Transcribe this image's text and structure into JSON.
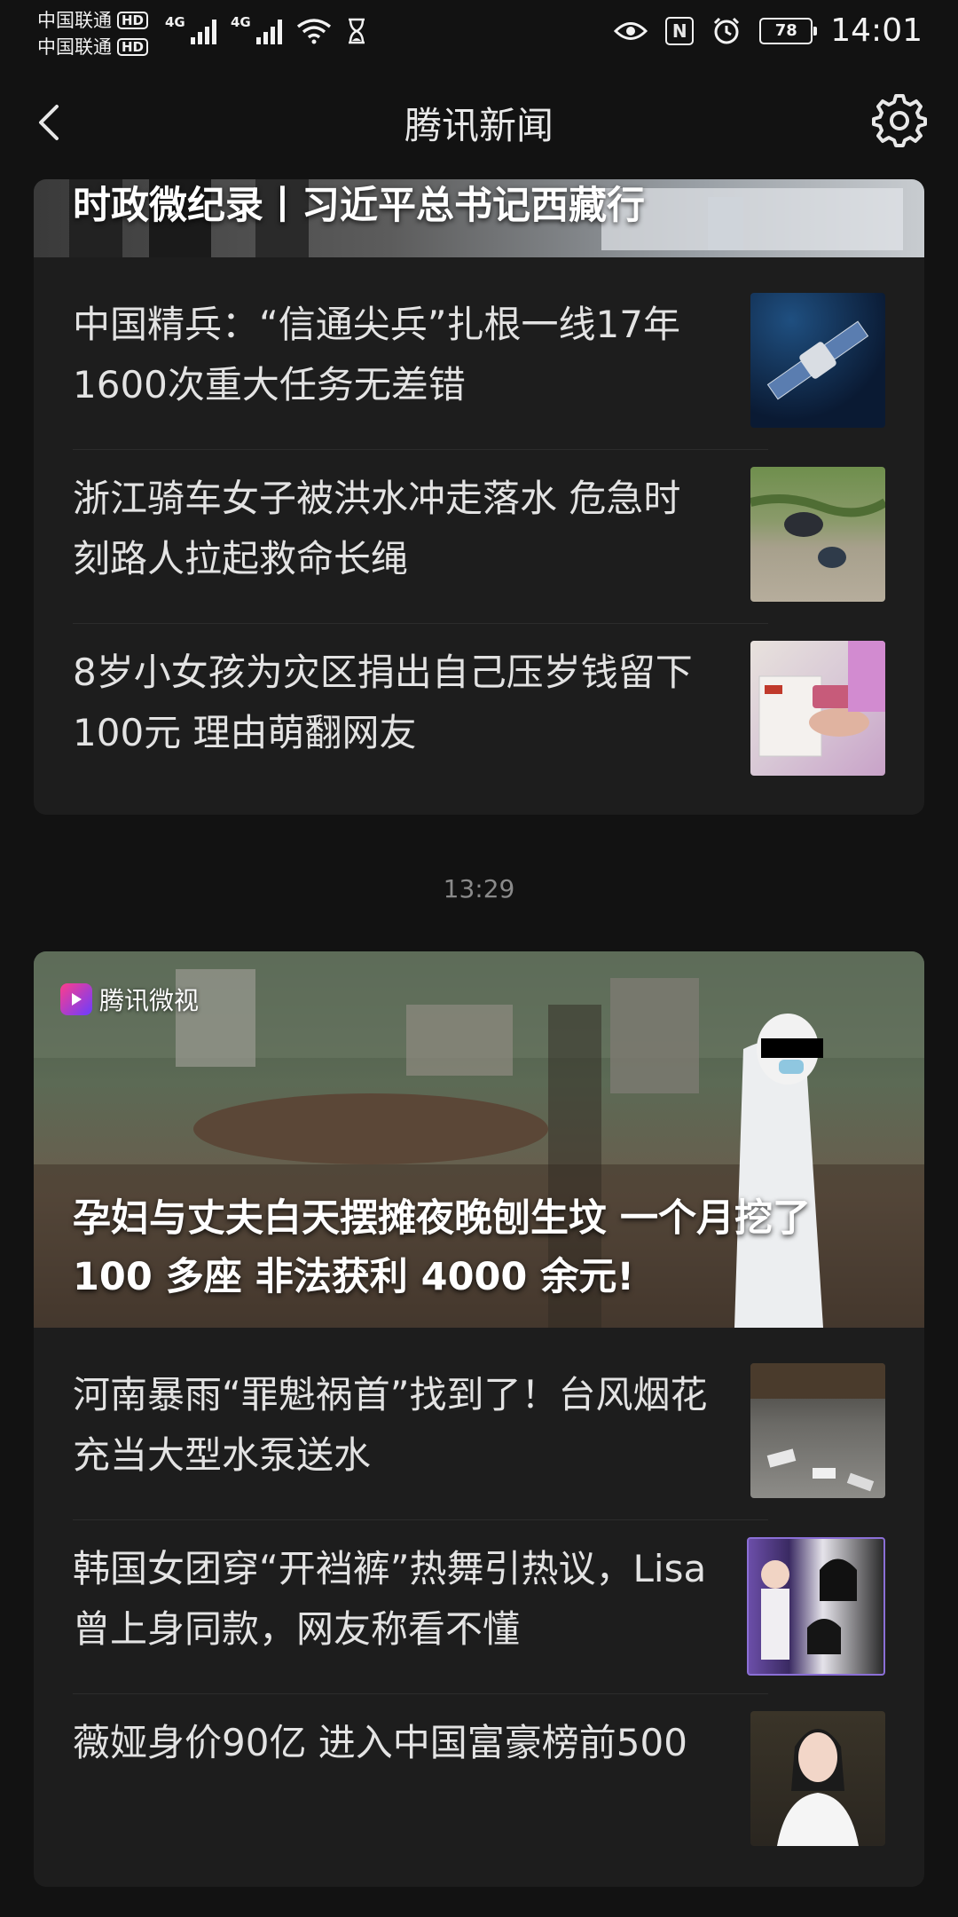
{
  "status_bar": {
    "carrier_1": "中国联通",
    "carrier_2": "中国联通",
    "hd_label": "HD",
    "network_1": "4G",
    "network_2": "4G",
    "battery": "78",
    "time": "14:01"
  },
  "header": {
    "title": "腾讯新闻"
  },
  "section_1": {
    "hero_title": "时政微纪录丨习近平总书记西藏行",
    "items": [
      {
        "title": "中国精兵：“信通尖兵”扎根一线17年 1600次重大任务无差错",
        "thumb_icon": "satellite-thumbnail"
      },
      {
        "title": "浙江骑车女子被洪水冲走落水 危急时刻路人拉起救命长绳",
        "thumb_icon": "flood-rescue-thumbnail"
      },
      {
        "title": "8岁小女孩为灾区捐出自己压岁钱留下100元 理由萌翻网友",
        "thumb_icon": "donation-thumbnail"
      }
    ]
  },
  "timestamp": "13:29",
  "section_2": {
    "badge": "腾讯微视",
    "hero_title": "孕妇与丈夫白天摆摊夜晚刨生坟 一个月挖了100 多座 非法获利 4000 余元!",
    "items": [
      {
        "title": "河南暴雨“罪魁祸首”找到了！台风烟花充当大型水泵送水",
        "thumb_icon": "flood-street-thumbnail"
      },
      {
        "title": "韩国女团穿“开裆裤”热舞引热议，Lisa曾上身同款，网友称看不懂",
        "thumb_icon": "girl-group-thumbnail"
      },
      {
        "title": "薇娅身价90亿 进入中国富豪榜前500",
        "thumb_icon": "portrait-thumbnail"
      }
    ]
  },
  "colors": {
    "background": "#121212",
    "card": "#1d1d1d",
    "text": "#e3e3e3"
  }
}
